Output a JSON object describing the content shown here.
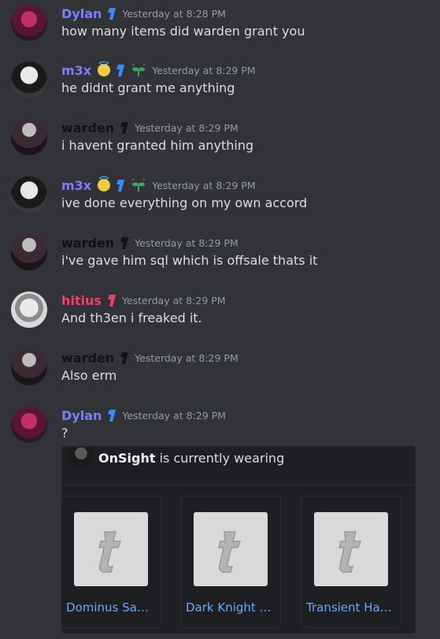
{
  "messages": [
    {
      "author": "Dylan",
      "timestamp": "Yesterday at 8:28 PM",
      "text": "how many items did warden grant you"
    },
    {
      "author": "m3x",
      "timestamp": "Yesterday at 8:29 PM",
      "text": "he didnt grant me anything"
    },
    {
      "author": "warden",
      "timestamp": "Yesterday at 8:29 PM",
      "text": "i havent granted him anything"
    },
    {
      "author": "m3x",
      "timestamp": "Yesterday at 8:29 PM",
      "text": "ive done everything on my own accord"
    },
    {
      "author": "warden",
      "timestamp": "Yesterday at 8:29 PM",
      "text": "i've gave him sql which is offsale thats it"
    },
    {
      "author": "hitius",
      "timestamp": "Yesterday at 8:29 PM",
      "text": "And th3en i freaked it."
    },
    {
      "author": "warden",
      "timestamp": "Yesterday at 8:29 PM",
      "text": "Also erm"
    },
    {
      "author": "Dylan",
      "timestamp": "Yesterday at 8:29 PM",
      "text": "?"
    }
  ],
  "embed": {
    "user": "OnSight",
    "suffix": " is currently wearing",
    "items": [
      {
        "name": "Dominus Sa…"
      },
      {
        "name": "Dark Knight …"
      },
      {
        "name": "Transient Ha…"
      }
    ]
  },
  "colors": {
    "background": "#313338",
    "username_blue": "#7d7dff",
    "username_warden": "#111214",
    "username_hitius": "#f23f6b",
    "link": "#6fa6ff"
  },
  "icons": [
    "role-badge-icon",
    "halo-smile-emoji-icon",
    "sprout-icon",
    "item-thumbnail-icon"
  ]
}
